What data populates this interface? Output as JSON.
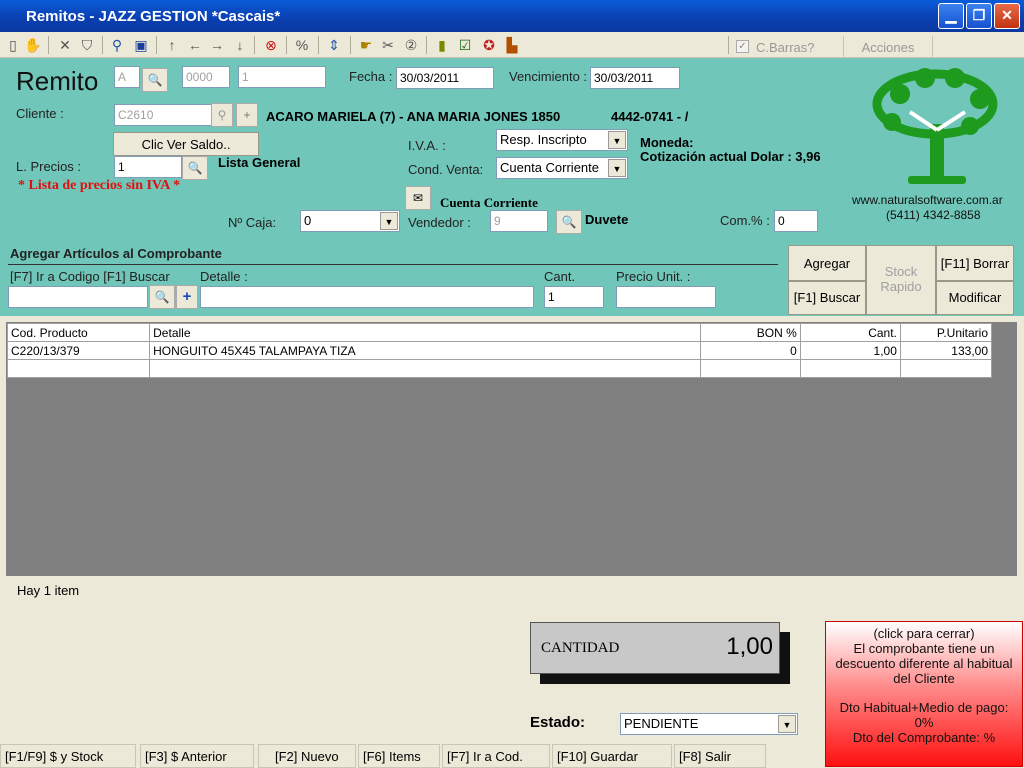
{
  "window": {
    "title": "Remitos - JAZZ GESTION *Cascais*",
    "min": "▁",
    "max": "❐",
    "close": "✕"
  },
  "toolbar": {
    "cbarras_label": "C.Barras?",
    "acciones_label": "Acciones"
  },
  "header": {
    "title": "Remito",
    "letra": "A",
    "punto_venta": "0000",
    "numero": "1",
    "fecha_label": "Fecha :",
    "fecha": "30/03/2011",
    "vencimiento_label": "Vencimiento :",
    "vencimiento": "30/03/2011",
    "cliente_label": "Cliente :",
    "cliente_code": "C2610",
    "cliente_info": "ACARO MARIELA (7) - ANA MARIA JONES 1850",
    "cliente_phone": "4442-0741 - /",
    "ver_saldo": "Clic Ver Saldo..",
    "iva_label": "I.V.A. :",
    "iva_value": "Resp. Inscripto",
    "moneda_label": "Moneda:",
    "cotizacion": "Cotización actual Dolar : 3,96",
    "lprecios_label": "L. Precios :",
    "lprecios_value": "1",
    "lista_general": "Lista General",
    "sin_iva": "* Lista de precios sin IVA *",
    "condventa_label": "Cond. Venta:",
    "condventa_value": "Cuenta Corriente",
    "cuenta_corriente": "Cuenta Corriente",
    "caja_label": "Nº Caja:",
    "caja_value": "0",
    "vendedor_label": "Vendedor :",
    "vendedor_code": "9",
    "vendedor_name": "Duvete",
    "com_label": "Com.% :",
    "com_value": "0",
    "website": "www.naturalsoftware.com.ar",
    "phone": "(5411) 4342-8858"
  },
  "add": {
    "title": "Agregar Artículos al Comprobante",
    "codigo_label": "[F7] Ir a Codigo [F1] Buscar",
    "detalle_label": "Detalle :",
    "cant_label": "Cant.",
    "cant_value": "1",
    "precio_label": "Precio Unit. :",
    "agregar": "Agregar",
    "stock_rapido": "Stock Rapido",
    "borrar": "[F11] Borrar",
    "buscar": "[F1] Buscar",
    "modificar": "Modificar"
  },
  "table": {
    "columns": [
      "Cod. Producto",
      "Detalle",
      "BON %",
      "Cant.",
      "P.Unitario"
    ],
    "rows": [
      [
        "C220/13/379",
        "HONGUITO 45X45 TALAMPAYA TIZA",
        "0",
        "1,00",
        "133,00"
      ]
    ]
  },
  "footer": {
    "items_count": "Hay 1 item",
    "cantidad_label": "CANTIDAD",
    "cantidad_value": "1,00",
    "estado_label": "Estado:",
    "estado_value": "PENDIENTE",
    "notice_close": "(click para cerrar)",
    "notice_text": "El comprobante tiene un descuento diferente al habitual del Cliente",
    "notice_dto": "Dto Habitual+Medio de pago: 0%",
    "notice_dto_comp": "Dto del Comprobante: %"
  },
  "statusbar": [
    "[F1/F9] $ y Stock",
    "[F3] $ Anterior",
    "[F2] Nuevo",
    "[F6] Items",
    "[F7] Ir a Cod.",
    "[F10] Guardar",
    "[F8] Salir"
  ],
  "colors": {
    "form_bg": "#70c6b8",
    "grid_bg": "#808080",
    "notice_red": "#ff1a1a",
    "title_blue": "#0a4fc8"
  }
}
